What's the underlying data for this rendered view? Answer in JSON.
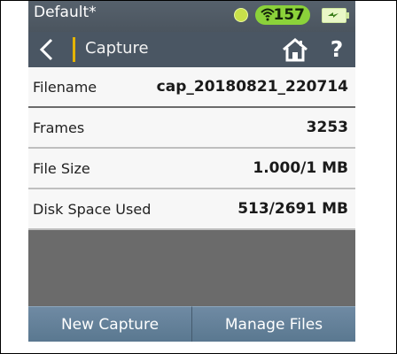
{
  "status": {
    "profile": "Default*",
    "signal_count": "157",
    "colors": {
      "pill": "#8bd23a",
      "dot": "#c8e04a",
      "battery": "#e9f7c7"
    }
  },
  "header": {
    "title": "Capture",
    "help_label": "?",
    "accent_color": "#e4b400"
  },
  "rows": [
    {
      "label": "Filename",
      "value": "cap_20180821_220714"
    },
    {
      "label": "Frames",
      "value": "3253"
    },
    {
      "label": "File Size",
      "value": "1.000/1 MB"
    },
    {
      "label": "Disk Space Used",
      "value": "513/2691 MB"
    }
  ],
  "buttons": {
    "new_capture": "New Capture",
    "manage_files": "Manage Files"
  },
  "icons": [
    "back-chevron-icon",
    "home-icon",
    "help-icon",
    "wifi-icon",
    "battery-icon",
    "status-dot-icon"
  ]
}
